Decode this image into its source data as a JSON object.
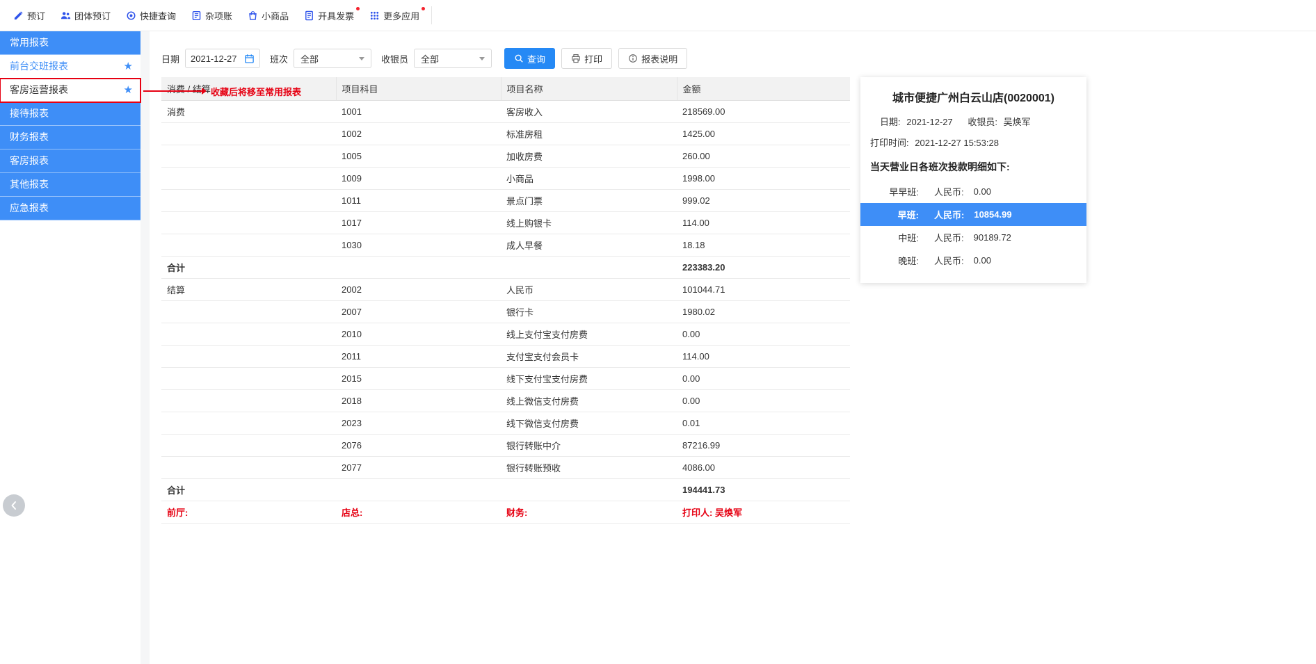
{
  "colors": {
    "sidebar_blue": "#3e8ef7",
    "accent_blue": "#2589f5",
    "icon_blue": "#2f54eb",
    "alert_red": "#e60012",
    "highlight_blue": "#3e8ef7"
  },
  "topbar": {
    "items": [
      {
        "label": "预订",
        "icon": "pencil-icon",
        "badge": false
      },
      {
        "label": "团体预订",
        "icon": "group-icon",
        "badge": false
      },
      {
        "label": "快捷查询",
        "icon": "target-icon",
        "badge": false
      },
      {
        "label": "杂项账",
        "icon": "ledger-icon",
        "badge": false
      },
      {
        "label": "小商品",
        "icon": "bag-icon",
        "badge": false
      },
      {
        "label": "开具发票",
        "icon": "invoice-icon",
        "badge": true
      },
      {
        "label": "更多应用",
        "icon": "apps-grid-icon",
        "badge": true
      }
    ]
  },
  "sidebar": {
    "items": [
      {
        "label": "常用报表",
        "style": "blue",
        "starred": false,
        "annotated": false
      },
      {
        "label": "前台交班报表",
        "style": "active",
        "starred": true,
        "annotated": false
      },
      {
        "label": "客房运营报表",
        "style": "selected",
        "starred": true,
        "annotated": true
      },
      {
        "label": "接待报表",
        "style": "blue",
        "starred": false,
        "annotated": false
      },
      {
        "label": "财务报表",
        "style": "blue",
        "starred": false,
        "annotated": false
      },
      {
        "label": "客房报表",
        "style": "blue",
        "starred": false,
        "annotated": false
      },
      {
        "label": "其他报表",
        "style": "blue",
        "starred": false,
        "annotated": false
      },
      {
        "label": "应急报表",
        "style": "blue",
        "starred": false,
        "annotated": false
      }
    ]
  },
  "annotation": {
    "text": "收藏后将移至常用报表"
  },
  "filters": {
    "date": {
      "label": "日期",
      "value": "2021-12-27"
    },
    "shift": {
      "label": "班次",
      "value": "全部"
    },
    "cashier": {
      "label": "收银员",
      "value": "全部"
    },
    "query_button": "查询",
    "print_button": "打印",
    "info_button": "报表说明"
  },
  "table": {
    "headers": [
      "消费 / 结算",
      "项目科目",
      "项目名称",
      "金额"
    ],
    "rows": [
      {
        "group": "消费",
        "code": "1001",
        "name": "客房收入",
        "amount": "218569.00",
        "total": false
      },
      {
        "group": "",
        "code": "1002",
        "name": "标准房租",
        "amount": "1425.00",
        "total": false
      },
      {
        "group": "",
        "code": "1005",
        "name": "加收房费",
        "amount": "260.00",
        "total": false
      },
      {
        "group": "",
        "code": "1009",
        "name": "小商品",
        "amount": "1998.00",
        "total": false
      },
      {
        "group": "",
        "code": "1011",
        "name": "景点门票",
        "amount": "999.02",
        "total": false
      },
      {
        "group": "",
        "code": "1017",
        "name": "线上购银卡",
        "amount": "114.00",
        "total": false
      },
      {
        "group": "",
        "code": "1030",
        "name": "成人早餐",
        "amount": "18.18",
        "total": false
      },
      {
        "group": "合计",
        "code": "",
        "name": "",
        "amount": "223383.20",
        "total": true
      },
      {
        "group": "结算",
        "code": "2002",
        "name": "人民币",
        "amount": "101044.71",
        "total": false
      },
      {
        "group": "",
        "code": "2007",
        "name": "银行卡",
        "amount": "1980.02",
        "total": false
      },
      {
        "group": "",
        "code": "2010",
        "name": "线上支付宝支付房费",
        "amount": "0.00",
        "total": false
      },
      {
        "group": "",
        "code": "2011",
        "name": "支付宝支付会员卡",
        "amount": "114.00",
        "total": false
      },
      {
        "group": "",
        "code": "2015",
        "name": "线下支付宝支付房费",
        "amount": "0.00",
        "total": false
      },
      {
        "group": "",
        "code": "2018",
        "name": "线上微信支付房费",
        "amount": "0.00",
        "total": false
      },
      {
        "group": "",
        "code": "2023",
        "name": "线下微信支付房费",
        "amount": "0.01",
        "total": false
      },
      {
        "group": "",
        "code": "2076",
        "name": "银行转账中介",
        "amount": "87216.99",
        "total": false
      },
      {
        "group": "",
        "code": "2077",
        "name": "银行转账预收",
        "amount": "4086.00",
        "total": false
      },
      {
        "group": "合计",
        "code": "",
        "name": "",
        "amount": "194441.73",
        "total": true
      }
    ],
    "signature_row": [
      "前厅:",
      "店总:",
      "财务:",
      "打印人: 吴焕军"
    ]
  },
  "summary": {
    "title": "城市便捷广州白云山店(0020001)",
    "date_label": "日期:",
    "date_value": "2021-12-27",
    "cashier_label": "收银员:",
    "cashier_value": "吴焕军",
    "print_time_label": "打印时间:",
    "print_time_value": "2021-12-27 15:53:28",
    "detail_heading": "当天营业日各班次投款明细如下:",
    "shifts": [
      {
        "name": "早早班:",
        "currency_label": "人民币:",
        "amount": "0.00",
        "highlighted": false
      },
      {
        "name": "早班:",
        "currency_label": "人民币:",
        "amount": "10854.99",
        "highlighted": true
      },
      {
        "name": "中班:",
        "currency_label": "人民币:",
        "amount": "90189.72",
        "highlighted": false
      },
      {
        "name": "晚班:",
        "currency_label": "人民币:",
        "amount": "0.00",
        "highlighted": false
      }
    ]
  }
}
